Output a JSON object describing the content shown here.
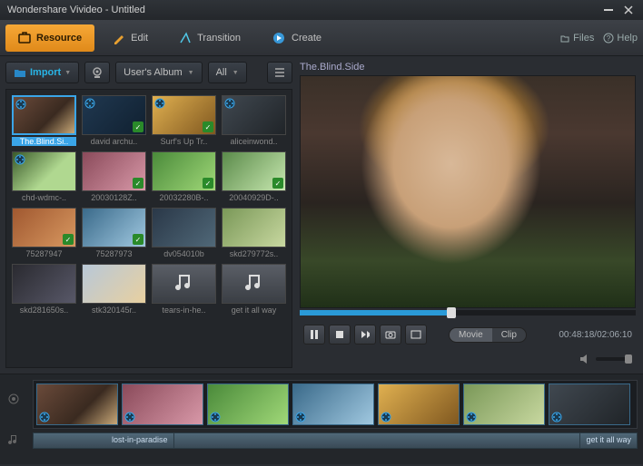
{
  "title": "Wondershare Vivideo - Untitled",
  "tabs": {
    "resource": "Resource",
    "edit": "Edit",
    "transition": "Transition",
    "create": "Create"
  },
  "toolRight": {
    "files": "Files",
    "help": "Help"
  },
  "importRow": {
    "import": "Import",
    "album": "User's Album",
    "filter": "All"
  },
  "grid": [
    {
      "label": "The.Blind.Si..",
      "fill": "f1",
      "selected": true,
      "video": true,
      "checked": false
    },
    {
      "label": "david archu..",
      "fill": "f2",
      "video": true,
      "checked": true
    },
    {
      "label": "Surf's Up Tr..",
      "fill": "f3",
      "video": true,
      "checked": true
    },
    {
      "label": "aliceinwond..",
      "fill": "f4",
      "video": true,
      "checked": false
    },
    {
      "label": "chd-wdmc-..",
      "fill": "f5",
      "video": true,
      "checked": false
    },
    {
      "label": "20030128Z..",
      "fill": "f6",
      "video": false,
      "checked": true
    },
    {
      "label": "20032280B-..",
      "fill": "f7",
      "video": false,
      "checked": true
    },
    {
      "label": "20040929D-..",
      "fill": "f8",
      "video": false,
      "checked": true
    },
    {
      "label": "75287947",
      "fill": "f9",
      "video": false,
      "checked": true
    },
    {
      "label": "75287973",
      "fill": "f10",
      "video": false,
      "checked": true
    },
    {
      "label": "dv054010b",
      "fill": "f11",
      "video": false,
      "checked": false
    },
    {
      "label": "skd279772s..",
      "fill": "f12",
      "video": false,
      "checked": false
    },
    {
      "label": "skd281650s..",
      "fill": "f13",
      "video": false,
      "checked": false
    },
    {
      "label": "stk320145r..",
      "fill": "f14",
      "video": false,
      "checked": false
    },
    {
      "label": "tears-in-he..",
      "fill": "audio",
      "video": false,
      "checked": false,
      "audio": true
    },
    {
      "label": "get it all way",
      "fill": "audio",
      "video": false,
      "checked": false,
      "audio": true
    }
  ],
  "preview": {
    "title": "The.Blind.Side",
    "time": "00:48:18/02:06:10",
    "movie": "Movie",
    "clip": "Clip"
  },
  "timeline": {
    "clips": [
      "f1",
      "f6",
      "f7",
      "f10",
      "f3",
      "f12",
      "f4"
    ],
    "audio1": "lost-in-paradise",
    "audio2": "get it all way"
  }
}
